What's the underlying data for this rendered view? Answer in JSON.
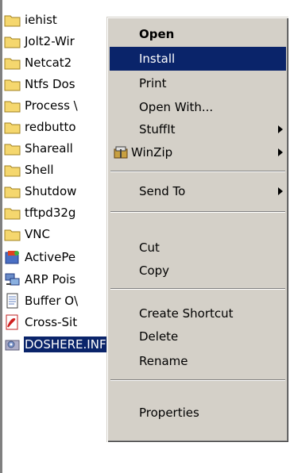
{
  "files": [
    {
      "name": "iehist",
      "icon": "folder-icon"
    },
    {
      "name": "Jolt2-Wir",
      "icon": "folder-icon"
    },
    {
      "name": "Netcat2",
      "icon": "folder-icon"
    },
    {
      "name": "Ntfs Dos",
      "icon": "folder-icon"
    },
    {
      "name": "Process \\",
      "icon": "folder-icon"
    },
    {
      "name": "redbutto",
      "icon": "folder-icon"
    },
    {
      "name": "Shareall",
      "icon": "folder-icon"
    },
    {
      "name": "Shell",
      "icon": "folder-icon"
    },
    {
      "name": "Shutdow",
      "icon": "folder-icon"
    },
    {
      "name": "tftpd32g",
      "icon": "folder-icon"
    },
    {
      "name": "VNC",
      "icon": "folder-icon"
    },
    {
      "name": "ActivePe",
      "icon": "installer-icon"
    },
    {
      "name": "ARP Pois",
      "icon": "network-program-icon"
    },
    {
      "name": "Buffer O\\",
      "icon": "text-document-icon"
    },
    {
      "name": "Cross-Sit",
      "icon": "pdf-icon"
    },
    {
      "name": "DOSHERE.INF",
      "icon": "setup-information-icon",
      "selected": true
    }
  ],
  "menu": {
    "open": "Open",
    "install": "Install",
    "print": "Print",
    "open_with": "Open With...",
    "stuffit": "StuffIt",
    "winzip": "WinZip",
    "send_to": "Send To",
    "cut": "Cut",
    "copy": "Copy",
    "create_shortcut": "Create Shortcut",
    "delete": "Delete",
    "rename": "Rename",
    "properties": "Properties",
    "highlighted": "install"
  },
  "colors": {
    "selection": "#0a246a",
    "menu_face": "#d4d0c8",
    "folder": "#f5d76e"
  }
}
